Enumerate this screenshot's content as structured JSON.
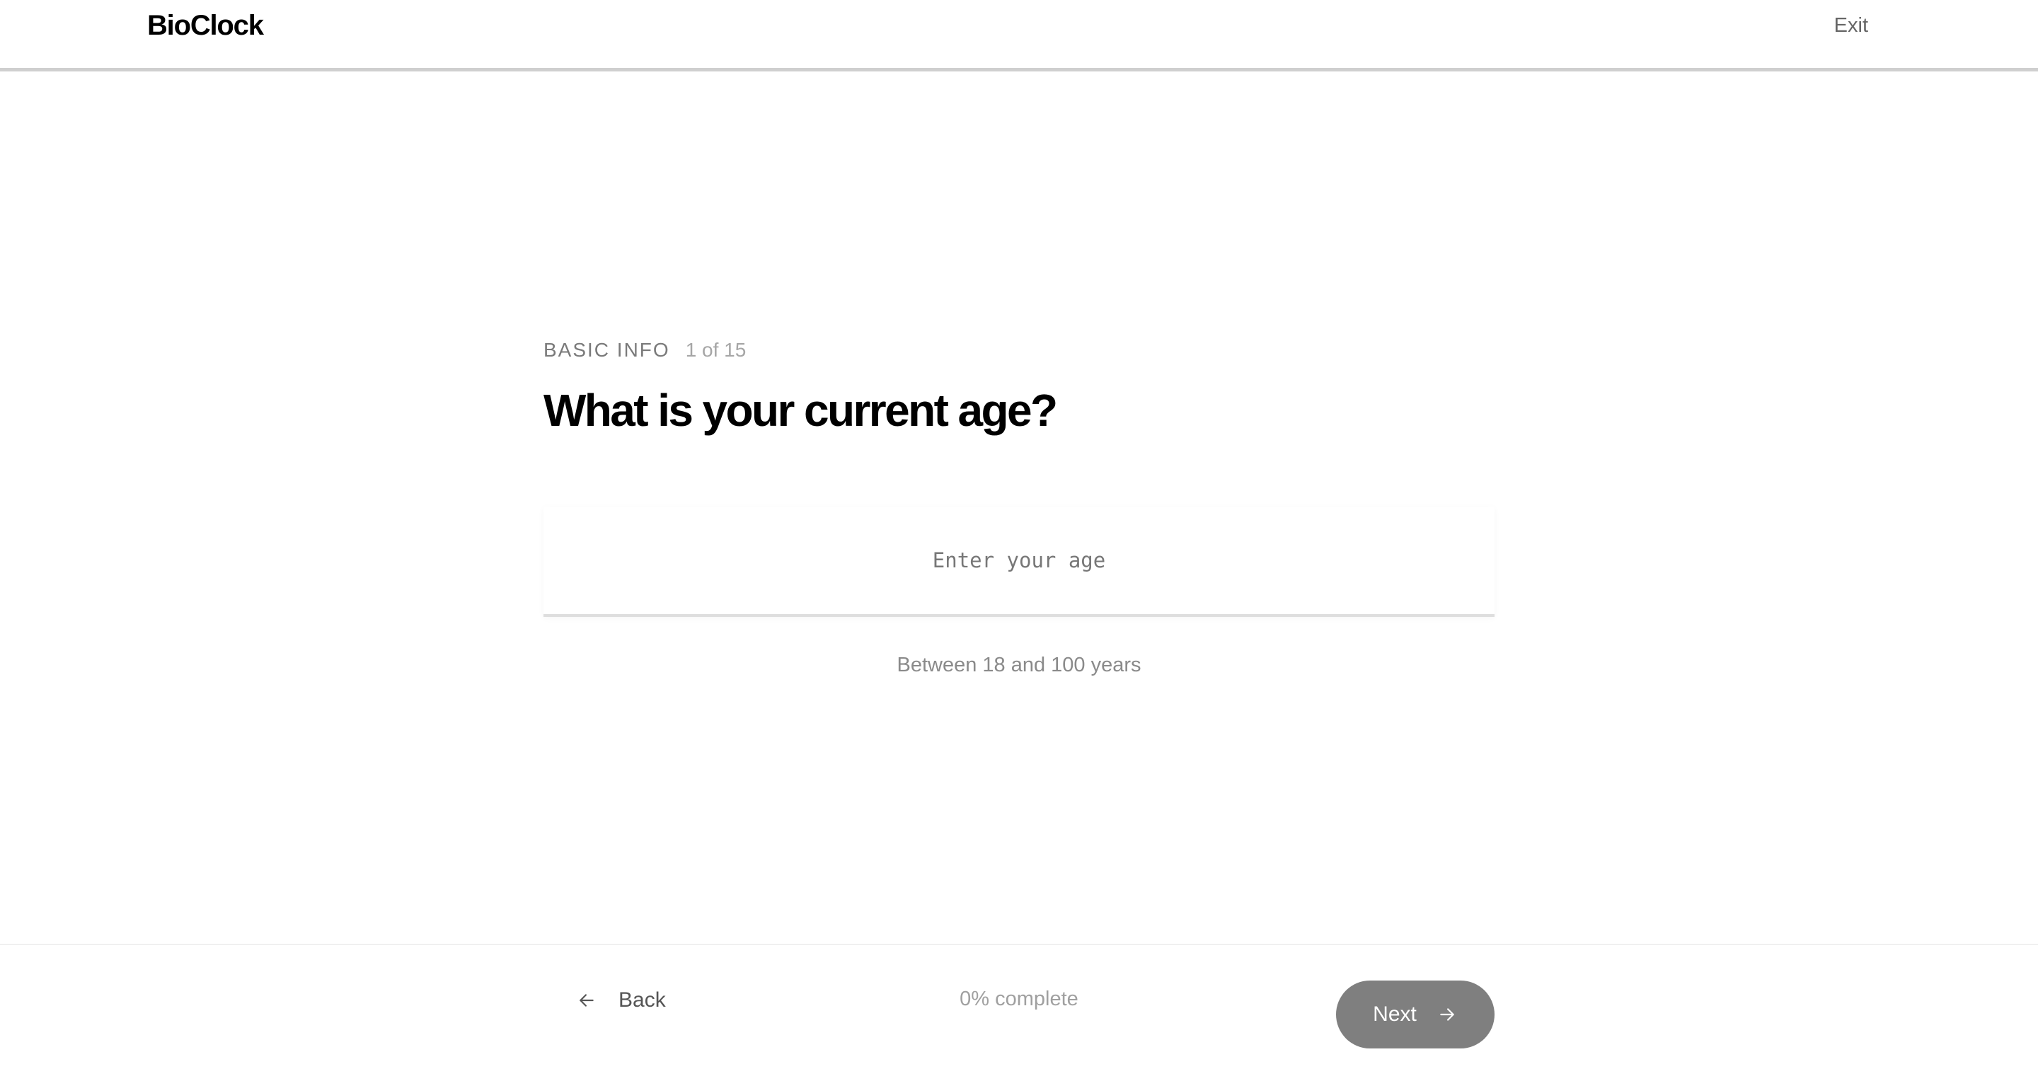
{
  "app": {
    "brand": "BioClock",
    "exit_label": "Exit"
  },
  "question": {
    "section": "BASIC INFO",
    "step": "1 of 15",
    "title": "What is your current age?",
    "input_placeholder": "Enter your age",
    "input_value": "",
    "hint": "Between 18 and 100 years"
  },
  "footer": {
    "back_label": "Back",
    "progress_text": "0% complete",
    "progress_percent": 0,
    "next_label": "Next"
  },
  "icons": {
    "back": "arrow-left-icon",
    "next": "arrow-right-icon"
  },
  "colors": {
    "next_button_bg": "#7f7f7f",
    "header_divider": "#cfcfcf",
    "muted_text": "#8a8a8a"
  }
}
